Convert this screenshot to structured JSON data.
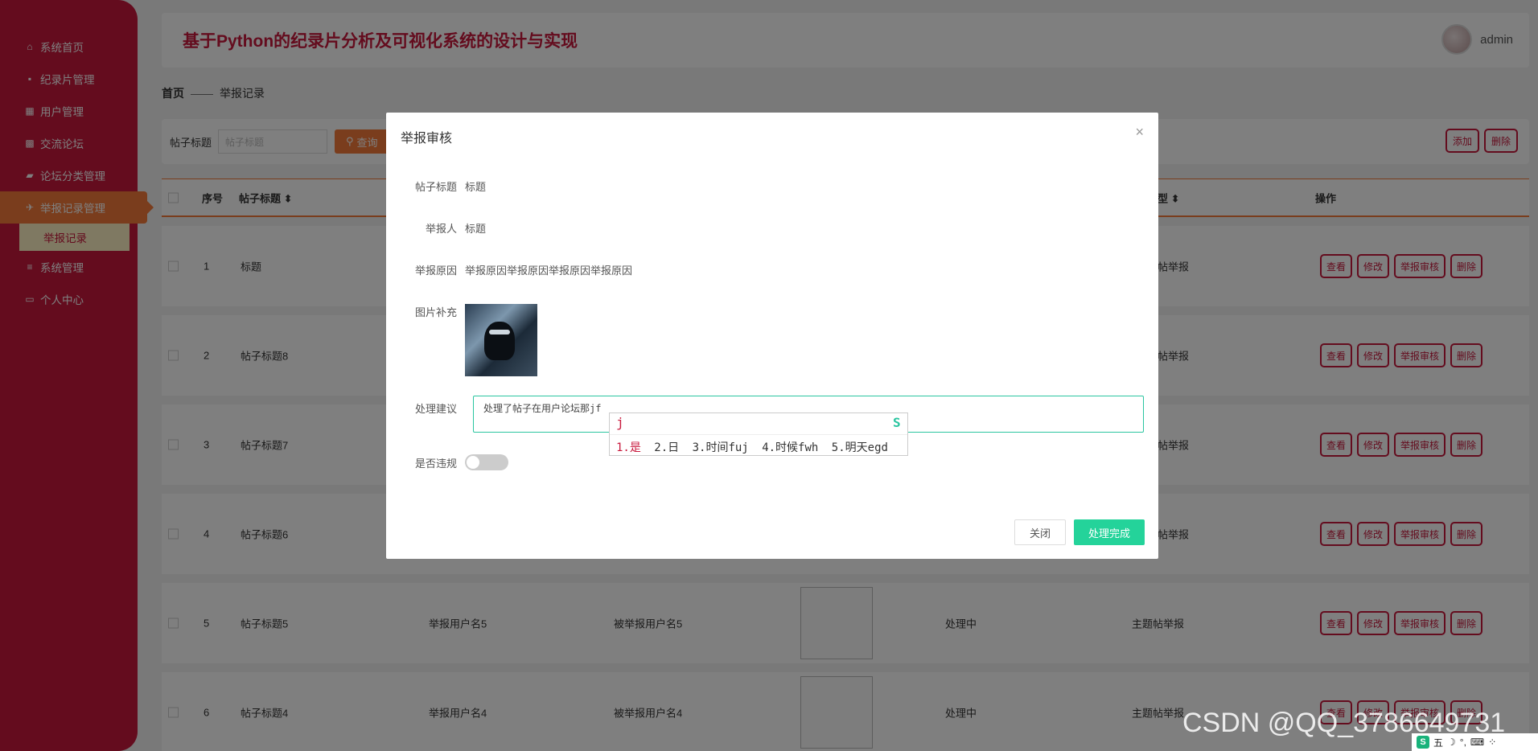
{
  "sidebar": {
    "items": [
      {
        "label": "系统首页",
        "icon": "home-icon",
        "glyph": "⌂"
      },
      {
        "label": "纪录片管理",
        "icon": "film-icon",
        "glyph": "▪"
      },
      {
        "label": "用户管理",
        "icon": "grid-icon",
        "glyph": "▦"
      },
      {
        "label": "交流论坛",
        "icon": "apps-icon",
        "glyph": "▩"
      },
      {
        "label": "论坛分类管理",
        "icon": "comment-icon",
        "glyph": "▰"
      },
      {
        "label": "举报记录管理",
        "icon": "send-icon",
        "glyph": "✈"
      },
      {
        "label": "系统管理",
        "icon": "menu-icon",
        "glyph": "≡"
      },
      {
        "label": "个人中心",
        "icon": "card-icon",
        "glyph": "▭"
      }
    ],
    "active_sub": "举报记录"
  },
  "header": {
    "title": "基于Python的纪录片分析及可视化系统的设计与实现",
    "user": "admin"
  },
  "breadcrumb": {
    "home": "首页",
    "sep": "——",
    "current": "举报记录"
  },
  "search": {
    "label": "帖子标题",
    "placeholder": "帖子标题",
    "button": "查询",
    "add": "添加",
    "delete": "删除"
  },
  "table": {
    "headers": {
      "index": "序号",
      "title": "帖子标题 ⬍",
      "type": "型 ⬍",
      "actions": "操作"
    },
    "rows": [
      {
        "index": "1",
        "title": "标题",
        "reporter": "",
        "reported": "",
        "status": "",
        "type": "帖举报"
      },
      {
        "index": "2",
        "title": "帖子标题8",
        "reporter": "",
        "reported": "",
        "status": "",
        "type": "帖举报"
      },
      {
        "index": "3",
        "title": "帖子标题7",
        "reporter": "",
        "reported": "",
        "status": "",
        "type": "帖举报"
      },
      {
        "index": "4",
        "title": "帖子标题6",
        "reporter": "",
        "reported": "",
        "status": "",
        "type": "帖举报"
      },
      {
        "index": "5",
        "title": "帖子标题5",
        "reporter": "举报用户名5",
        "reported": "被举报用户名5",
        "status": "处理中",
        "type": "主题帖举报"
      },
      {
        "index": "6",
        "title": "帖子标题4",
        "reporter": "举报用户名4",
        "reported": "被举报用户名4",
        "status": "处理中",
        "type": "主题帖举报"
      }
    ],
    "row_actions": {
      "view": "查看",
      "edit": "修改",
      "review": "举报审核",
      "delete": "删除"
    }
  },
  "modal": {
    "title": "举报审核",
    "close_glyph": "×",
    "fields": {
      "post_title_label": "帖子标题",
      "post_title": "标题",
      "reporter_label": "举报人",
      "reporter": "标题",
      "reason_label": "举报原因",
      "reason": "举报原因举报原因举报原因举报原因",
      "image_label": "图片补充",
      "suggestion_label": "处理建议",
      "suggestion": "处理了帖子在用户论坛那jf",
      "violation_label": "是否违规",
      "violation": false
    },
    "buttons": {
      "close": "关闭",
      "done": "处理完成"
    }
  },
  "ime": {
    "input": "j",
    "candidates": [
      {
        "text": "1.是"
      },
      {
        "text": "2.日"
      },
      {
        "text": "3.时间fuj"
      },
      {
        "text": "4.时候fwh"
      },
      {
        "text": "5.明天egd"
      }
    ]
  },
  "watermark": "CSDN @QQ_3786649731",
  "tray": {
    "ime_mode": "五"
  }
}
